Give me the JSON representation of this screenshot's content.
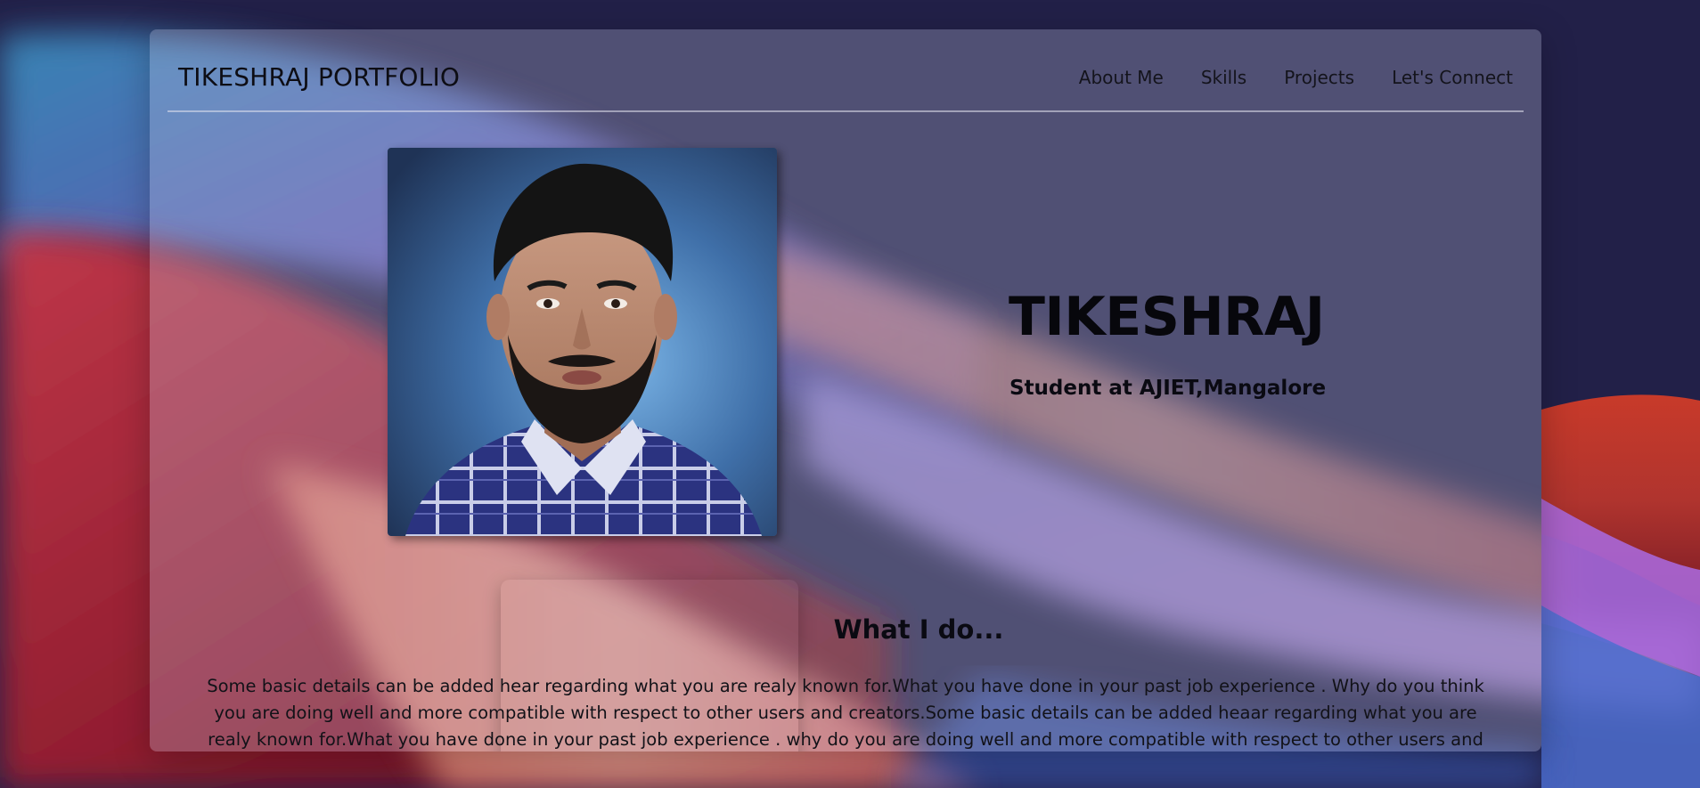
{
  "nav": {
    "brand": "TIKESHRAJ PORTFOLIO",
    "links": [
      "About Me",
      "Skills",
      "Projects",
      "Let's Connect"
    ]
  },
  "hero": {
    "name": "TIKESHRAJ",
    "subtitle": "Student at AJIET,Mangalore"
  },
  "about": {
    "title": "What I do...",
    "body": "Some basic details can be added hear regarding what you are realy known for.What you have done in your past job experience . Why do you think you are doing well and more compatible with respect to other users and creators.Some basic details can be added heaar regarding what you are realy known for.What you have done in your past job experience . why do you are doing well and more compatible with respect to other users and"
  },
  "colors": {
    "page_background": "#22204a",
    "card_tint": "#c8cde6",
    "text": "#0a0a12"
  }
}
